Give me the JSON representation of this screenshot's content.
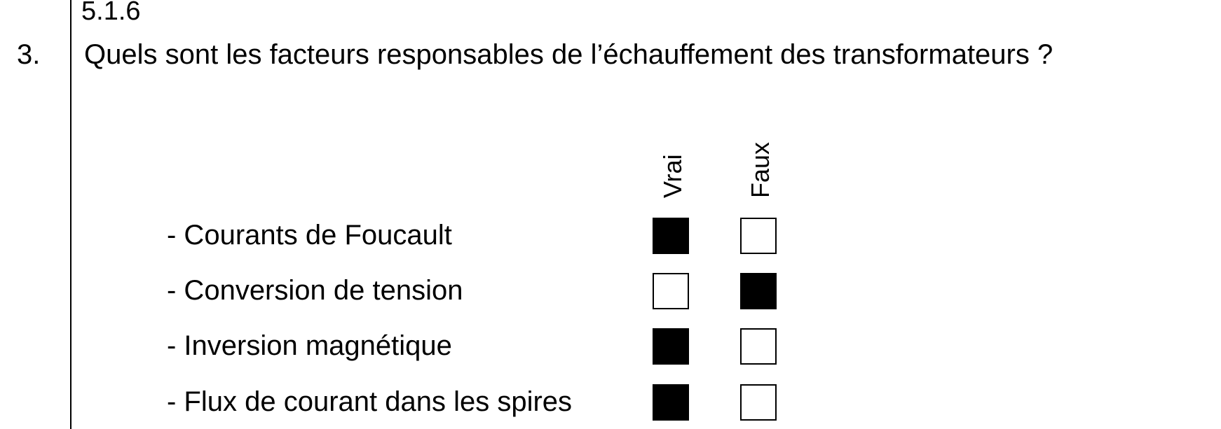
{
  "section_ref": "5.1.6",
  "question": {
    "number": "3.",
    "text": "Quels sont les facteurs responsables de l’échauffement des transformateurs ?"
  },
  "columns": {
    "vrai": "Vrai",
    "faux": "Faux"
  },
  "items": [
    {
      "label": "- Courants de Foucault",
      "vrai": true,
      "faux": false
    },
    {
      "label": "- Conversion de tension",
      "vrai": false,
      "faux": true
    },
    {
      "label": "- Inversion magnétique",
      "vrai": true,
      "faux": false
    },
    {
      "label": "- Flux de courant dans les spires",
      "vrai": true,
      "faux": false
    }
  ]
}
